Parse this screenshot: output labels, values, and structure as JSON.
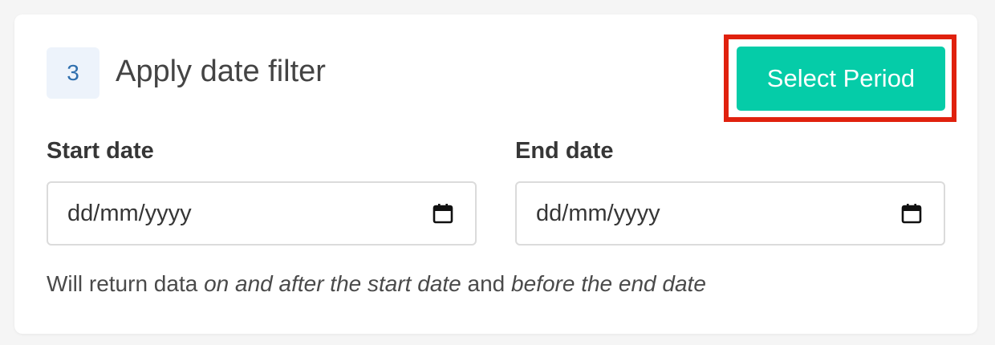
{
  "step": {
    "number": "3",
    "title": "Apply date filter"
  },
  "actions": {
    "select_period_label": "Select Period"
  },
  "start_date": {
    "label": "Start date",
    "placeholder": "dd/mm/yyyy",
    "icon": "calendar-icon"
  },
  "end_date": {
    "label": "End date",
    "placeholder": "dd/mm/yyyy",
    "icon": "calendar-icon"
  },
  "hint": {
    "part1": "Will return data ",
    "part2": "on and after the start date",
    "part3": " and ",
    "part4": "before the end date"
  },
  "colors": {
    "accent": "#05cca8",
    "highlight": "#e0210e",
    "badge_bg": "#edf3fb",
    "badge_text": "#2f6fae"
  }
}
